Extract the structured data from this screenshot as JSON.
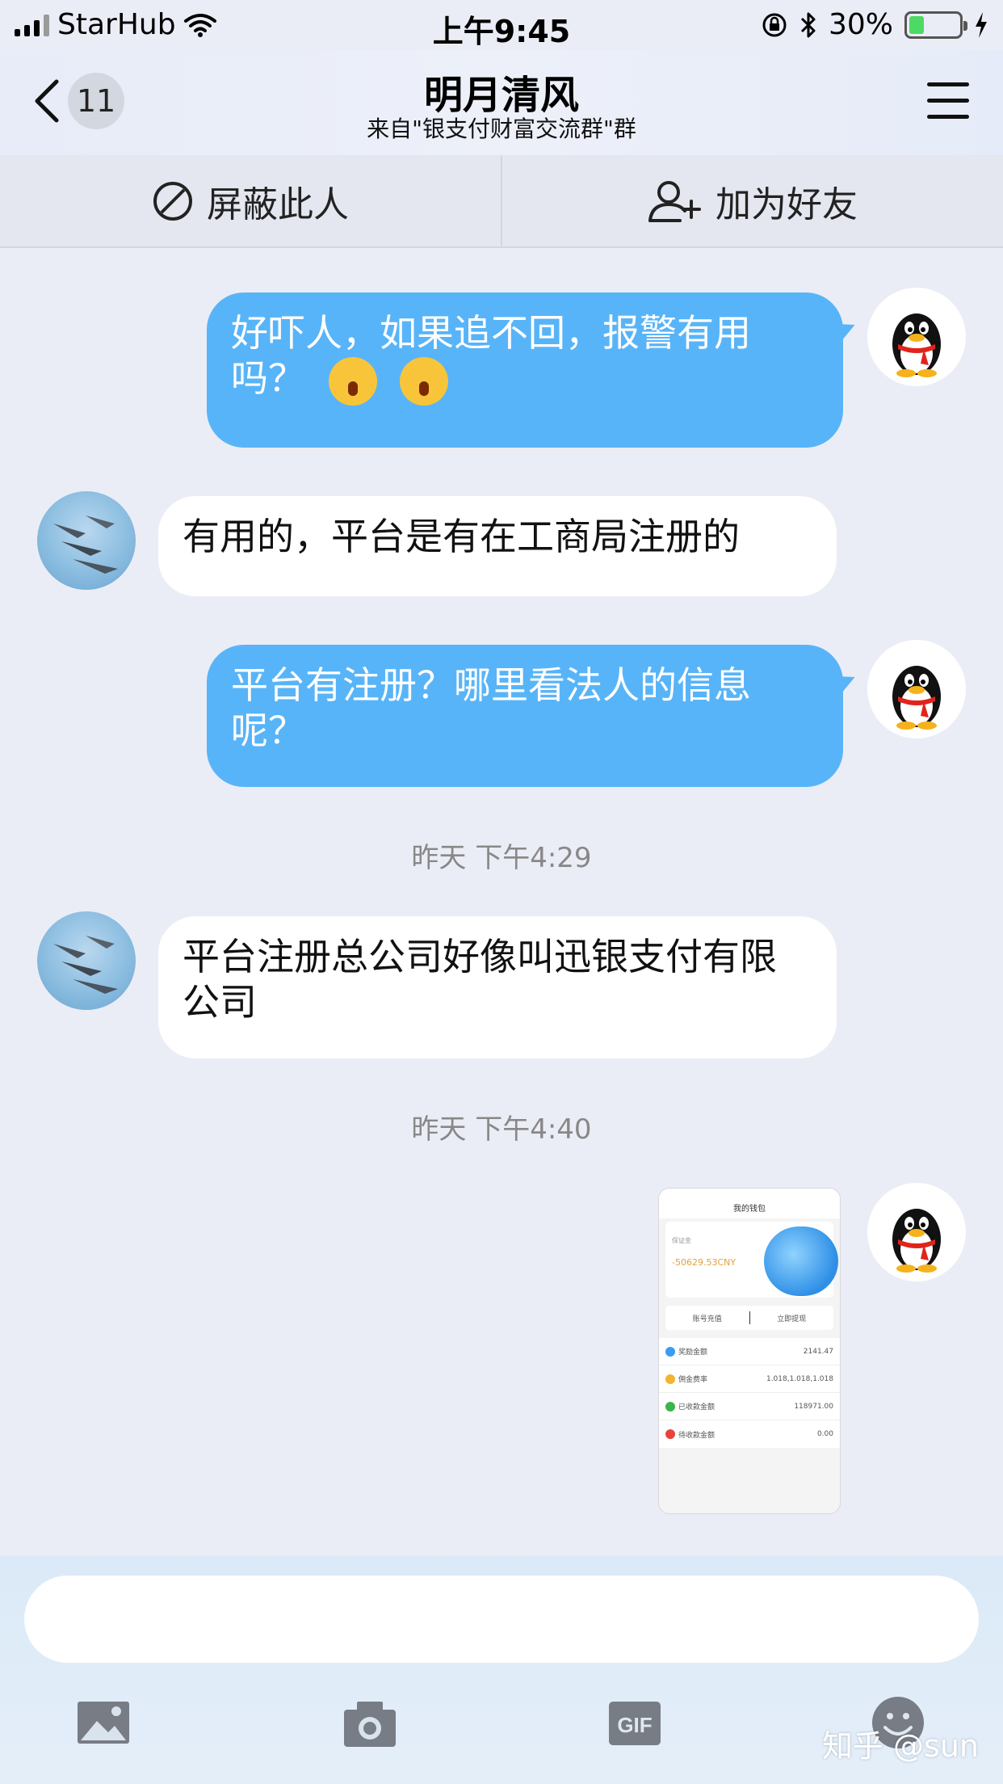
{
  "status_bar": {
    "carrier": "StarHub",
    "time": "上午9:45",
    "battery": "30%"
  },
  "header": {
    "back_count": "11",
    "title": "明月清风",
    "subtitle": "来自\"银支付财富交流群\"群"
  },
  "actions": {
    "block": "屏蔽此人",
    "add_friend": "加为好友"
  },
  "messages": [
    {
      "side": "out",
      "text": "好吓人，如果追不回，报警有用吗？"
    },
    {
      "side": "in",
      "text": "有用的，平台是有在工商局注册的"
    },
    {
      "side": "out",
      "text": "平台有注册？哪里看法人的信息呢？"
    },
    {
      "side": "in",
      "text": "平台注册总公司好像叫迅银支付有限公司"
    }
  ],
  "timestamps": [
    "昨天 下午4:29",
    "昨天 下午4:40"
  ],
  "screenshot": {
    "title": "我的钱包",
    "deposit_label": "保证金",
    "deposit_value": "-50629.53CNY",
    "btn_recharge": "账号充值",
    "btn_withdraw": "立即提现",
    "rows": [
      {
        "label": "奖励金额",
        "value": "2141.47",
        "color": "#3b9cf0"
      },
      {
        "label": "佣金费率",
        "value": "1.018,1.018,1.018",
        "color": "#f2b530"
      },
      {
        "label": "已收款金额",
        "value": "118971.00",
        "color": "#3cb44b"
      },
      {
        "label": "待收款金额",
        "value": "0.00",
        "color": "#e8433a"
      }
    ]
  },
  "watermark": "知乎 @sun",
  "colors": {
    "bubble_out": "#58b4f8",
    "bubble_in": "#ffffff",
    "background": "#ebedf6"
  }
}
